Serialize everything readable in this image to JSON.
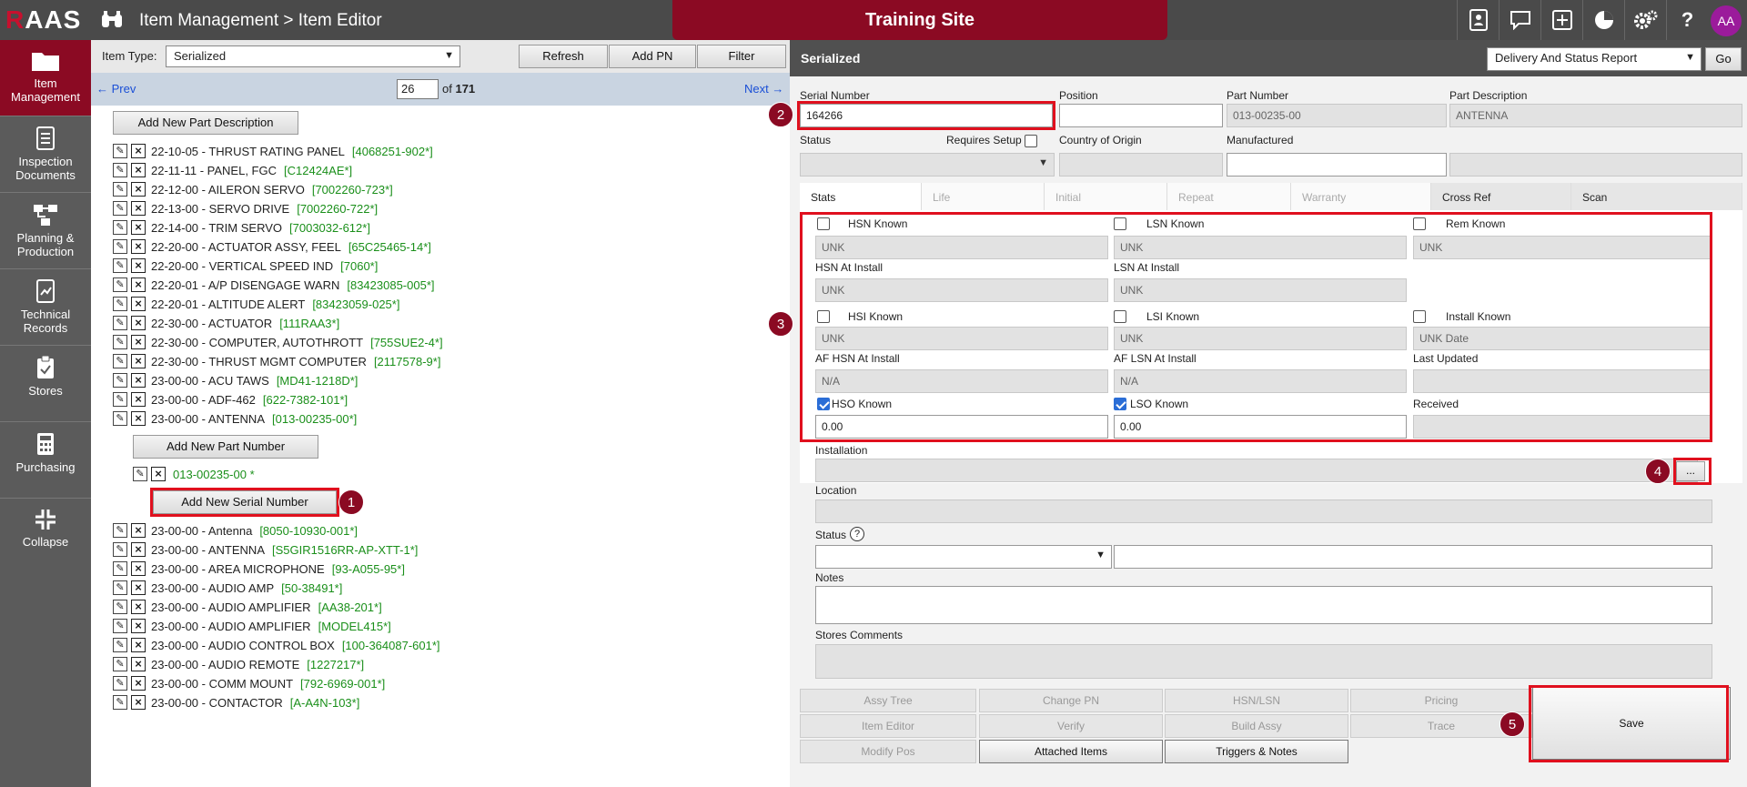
{
  "topbar": {
    "logo_r": "R",
    "logo_rest": "AAS",
    "breadcrumb": "Item Management > Item Editor",
    "site_banner": "Training Site",
    "avatar_initials": "AA"
  },
  "sidebar": {
    "items": [
      {
        "label": "Item Management",
        "icon": "folder-icon"
      },
      {
        "label": "Inspection Documents",
        "icon": "document-icon"
      },
      {
        "label": "Planning & Production",
        "icon": "flow-icon"
      },
      {
        "label": "Technical Records",
        "icon": "records-icon"
      },
      {
        "label": "Stores",
        "icon": "clipboard-icon"
      },
      {
        "label": "Purchasing",
        "icon": "calculator-icon"
      },
      {
        "label": "Collapse",
        "icon": "collapse-icon"
      }
    ]
  },
  "left": {
    "item_type_label": "Item Type:",
    "item_type_value": "Serialized",
    "refresh": "Refresh",
    "add_pn": "Add PN",
    "filter": "Filter",
    "prev": "← Prev",
    "next": "Next →",
    "page": "26",
    "of_text": "of",
    "total": "171",
    "add_part_description": "Add New Part Description",
    "add_part_number": "Add New Part Number",
    "add_serial_number": "Add New Serial Number",
    "expanded_pn": "013-00235-00 *",
    "items_top": [
      {
        "name": "22-10-05 - THRUST RATING PANEL",
        "pn": "[4068251-902*]"
      },
      {
        "name": "22-11-11 - PANEL, FGC",
        "pn": "[C12424AE*]"
      },
      {
        "name": "22-12-00 - AILERON SERVO",
        "pn": "[7002260-723*]"
      },
      {
        "name": "22-13-00 - SERVO DRIVE",
        "pn": "[7002260-722*]"
      },
      {
        "name": "22-14-00 - TRIM SERVO",
        "pn": "[7003032-612*]"
      },
      {
        "name": "22-20-00 - ACTUATOR ASSY, FEEL",
        "pn": "[65C25465-14*]"
      },
      {
        "name": "22-20-00 - VERTICAL SPEED IND",
        "pn": "[7060*]"
      },
      {
        "name": "22-20-01 - A/P DISENGAGE WARN",
        "pn": "[83423085-005*]"
      },
      {
        "name": "22-20-01 - ALTITUDE ALERT",
        "pn": "[83423059-025*]"
      },
      {
        "name": "22-30-00 - ACTUATOR",
        "pn": "[111RAA3*]"
      },
      {
        "name": "22-30-00 - COMPUTER, AUTOTHROTT",
        "pn": "[755SUE2-4*]"
      },
      {
        "name": "22-30-00 - THRUST MGMT COMPUTER",
        "pn": "[2117578-9*]"
      },
      {
        "name": "23-00-00 - ACU TAWS",
        "pn": "[MD41-1218D*]"
      },
      {
        "name": "23-00-00 - ADF-462",
        "pn": "[622-7382-101*]"
      },
      {
        "name": "23-00-00 - ANTENNA",
        "pn": "[013-00235-00*]"
      }
    ],
    "items_bottom": [
      {
        "name": "23-00-00 - Antenna",
        "pn": "[8050-10930-001*]"
      },
      {
        "name": "23-00-00 - ANTENNA",
        "pn": "[S5GIR1516RR-AP-XTT-1*]"
      },
      {
        "name": "23-00-00 - AREA MICROPHONE",
        "pn": "[93-A055-95*]"
      },
      {
        "name": "23-00-00 - AUDIO AMP",
        "pn": "[50-38491*]"
      },
      {
        "name": "23-00-00 - AUDIO AMPLIFIER",
        "pn": "[AA38-201*]"
      },
      {
        "name": "23-00-00 - AUDIO AMPLIFIER",
        "pn": "[MODEL415*]"
      },
      {
        "name": "23-00-00 - AUDIO CONTROL BOX",
        "pn": "[100-364087-601*]"
      },
      {
        "name": "23-00-00 - AUDIO REMOTE",
        "pn": "[1227217*]"
      },
      {
        "name": "23-00-00 - COMM MOUNT",
        "pn": "[792-6969-001*]"
      },
      {
        "name": "23-00-00 - CONTACTOR",
        "pn": "[A-A4N-103*]"
      }
    ]
  },
  "right": {
    "header_title": "Serialized",
    "report_select": "Delivery And Status Report",
    "go": "Go",
    "serial_number_label": "Serial Number",
    "serial_number_value": "164266",
    "position_label": "Position",
    "part_number_label": "Part Number",
    "part_number_value": "013-00235-00",
    "part_description_label": "Part Description",
    "part_description_value": "ANTENNA",
    "status_label": "Status",
    "requires_setup_label": "Requires Setup",
    "country_label": "Country of Origin",
    "manufactured_label": "Manufactured",
    "tabs": [
      "Stats",
      "Life",
      "Initial",
      "Repeat",
      "Warranty",
      "Cross Ref",
      "Scan"
    ],
    "stats": {
      "hsn_known": "HSN Known",
      "lsn_known": "LSN Known",
      "rem_known": "Rem Known",
      "unk": "UNK",
      "hsn_at_install": "HSN At Install",
      "lsn_at_install": "LSN At Install",
      "hsi_known": "HSI Known",
      "lsi_known": "LSI Known",
      "install_known": "Install Known",
      "unk_date": "UNK Date",
      "af_hsn": "AF HSN At Install",
      "af_lsn": "AF LSN At Install",
      "last_updated": "Last Updated",
      "na": "N/A",
      "hso_known": "HSO Known",
      "lso_known": "LSO Known",
      "received": "Received",
      "hso_value": "0.00",
      "lso_value": "0.00"
    },
    "installation_label": "Installation",
    "installation_btn": "...",
    "location_label": "Location",
    "status2_label": "Status",
    "help_glyph": "?",
    "notes_label": "Notes",
    "stores_comments_label": "Stores Comments",
    "actions": {
      "assy_tree": "Assy Tree",
      "change_pn": "Change PN",
      "hsn_lsn": "HSN/LSN",
      "pricing": "Pricing",
      "item_editor": "Item Editor",
      "verify": "Verify",
      "build_assy": "Build Assy",
      "trace": "Trace",
      "modify_pos": "Modify Pos",
      "attached_items": "Attached Items",
      "triggers_notes": "Triggers & Notes",
      "save": "Save"
    }
  },
  "badges": [
    "1",
    "2",
    "3",
    "4",
    "5"
  ],
  "colors": {
    "brand": "#8b0a23",
    "highlight": "#e0101e",
    "link": "#1a4fd6",
    "pn_green": "#1a8f1a"
  }
}
